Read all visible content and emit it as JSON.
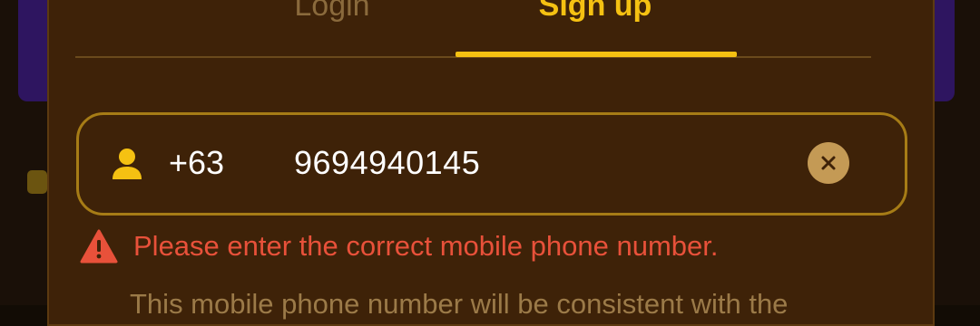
{
  "tabs": {
    "login_label": "Login",
    "signup_label": "Sign up",
    "active": "Sign up"
  },
  "phone_field": {
    "country_code": "+63",
    "value": "9694940145",
    "prefix_icon": "user-icon",
    "clear_icon": "close-icon"
  },
  "validation": {
    "icon": "warning-icon",
    "error_message": "Please enter the correct mobile phone number."
  },
  "hint": {
    "text": "This mobile phone number will be consistent with the"
  },
  "colors": {
    "accent": "#f5c112",
    "panel": "#3e2208",
    "error": "#e8513a",
    "field_border": "#a67c16"
  }
}
